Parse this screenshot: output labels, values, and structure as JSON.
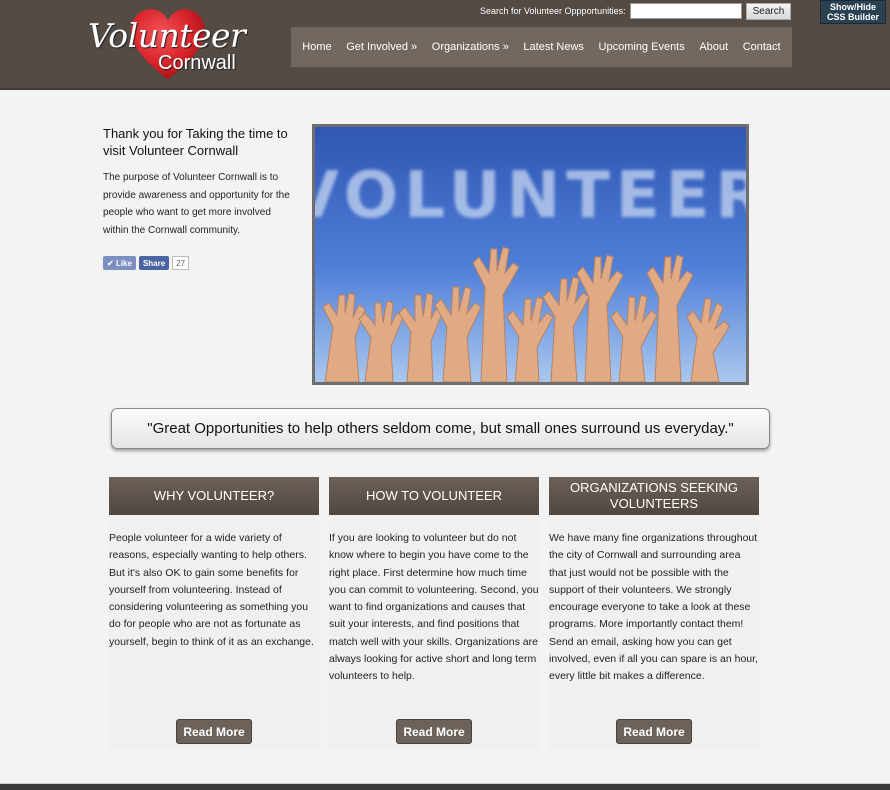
{
  "logo": {
    "word1": "Volunteer",
    "word2": "Cornwall"
  },
  "search": {
    "label": "Search for Volunteer Oppportunities:",
    "button": "Search"
  },
  "css_builder": {
    "line1": "Show/Hide",
    "line2": "CSS Builder"
  },
  "nav": {
    "items": [
      {
        "label": "Home"
      },
      {
        "label": "Get Involved »"
      },
      {
        "label": "Organizations »"
      },
      {
        "label": "Latest News"
      },
      {
        "label": "Upcoming Events"
      },
      {
        "label": "About"
      },
      {
        "label": "Contact"
      }
    ]
  },
  "intro": {
    "title": "Thank you for Taking the time to visit Volunteer Cornwall",
    "text": "The purpose of Volunteer Cornwall is to provide awareness and opportunity for the people who want to get more involved within the Cornwall community."
  },
  "social": {
    "like": "Like",
    "share": "Share",
    "count": "27"
  },
  "hero": {
    "word": "VOLUNTEER"
  },
  "quote": "\"Great Opportunities to help others seldom come, but small ones surround us everyday.\"",
  "columns": [
    {
      "title": "WHY VOLUNTEER?",
      "body": "People volunteer for a wide variety of reasons, especially wanting to help others. But it's also OK to gain some benefits for yourself from volunteering. Instead of considering volunteering as something you do for people who are not as fortunate as yourself, begin to think of it as an exchange.",
      "button": "Read More"
    },
    {
      "title": "HOW TO VOLUNTEER",
      "body": "If you are looking to volunteer but do not know where to begin you have come to the right place. First determine how much time you can commit to volunteering. Second, you want to find organizations and causes that suit your interests, and find positions that match well with your skills. Organizations are always looking for active short and long term volunteers to help.",
      "button": "Read More"
    },
    {
      "title": "ORGANIZATIONS SEEKING VOLUNTEERS",
      "body": "We have many fine organizations throughout the city of Cornwall and surrounding area that just would not be possible with the support of their volunteers. We strongly encourage everyone to take a look at these programs. More importantly contact them! Send an email, asking how you can get involved, even if all you can spare is an hour, every little bit makes a difference.",
      "button": "Read More"
    }
  ],
  "colors": {
    "header": "#544b45",
    "nav": "#736860",
    "heart": "#d8232a",
    "accent": "#6d6259"
  }
}
